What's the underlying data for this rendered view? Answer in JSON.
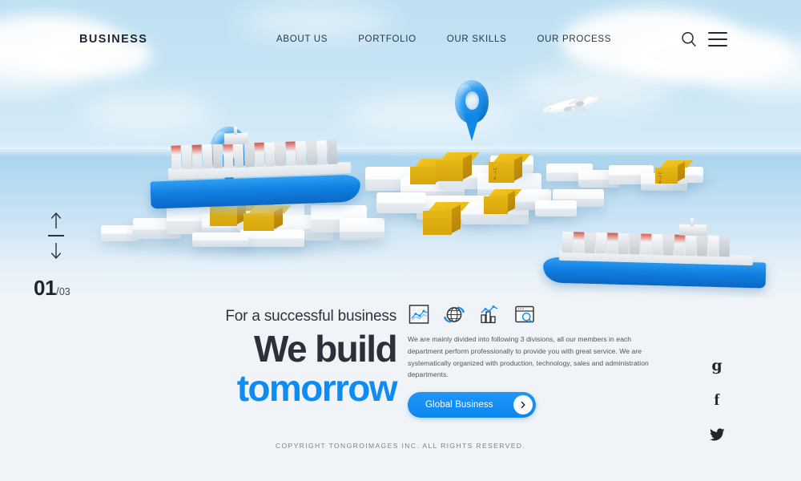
{
  "header": {
    "logo": "BUSINESS",
    "menu": [
      {
        "label": "ABOUT US"
      },
      {
        "label": "PORTFOLIO"
      },
      {
        "label": "OUR SKILLS"
      },
      {
        "label": "OUR PROCESS"
      }
    ],
    "search_icon": "search-icon",
    "menu_icon": "hamburger-menu-icon"
  },
  "slider": {
    "up_icon": "arrow-up-icon",
    "down_icon": "arrow-down-icon",
    "current": "01",
    "separator": "/",
    "total": "03"
  },
  "hero": {
    "kicker": "For a successful business",
    "line1": "We build",
    "line2": "tomorrow",
    "accent_color": "#0d8cf5",
    "heading_color": "#2b3138"
  },
  "features": {
    "icons": [
      {
        "name": "line-chart-icon",
        "label": "Analytics chart"
      },
      {
        "name": "globe-rotate-icon",
        "label": "Global network"
      },
      {
        "name": "bar-chart-trend-icon",
        "label": "Growth statistics"
      },
      {
        "name": "browser-search-icon",
        "label": "Search research"
      }
    ]
  },
  "body": {
    "paragraph": "We are mainly divided into following 3 divisions, all our members in each department perform professionally to provide you with great service. We are systematically organized with production, technology, sales and administration departments."
  },
  "cta": {
    "label": "Global Business",
    "icon": "chevron-right-icon",
    "color": "#0d86ef"
  },
  "social": [
    {
      "name": "google-icon",
      "glyph": "g"
    },
    {
      "name": "facebook-icon",
      "glyph": "f"
    },
    {
      "name": "twitter-icon",
      "glyph": "twitter-bird"
    }
  ],
  "footer": {
    "copyright": "COPYRIGHT TONGROIMAGES INC. ALL RIGHTS RESERVED."
  },
  "scene": {
    "description": "3D isometric world map with cargo ships, airplane, map pins and yellow shipping boxes",
    "sky_color": "#c4e2f3",
    "sea_color": "#b5daf0",
    "land_color": "#ffffff",
    "pin_color": "#1e96f0",
    "box_color": "#e8b514",
    "ship_hull_color": "#1180e2",
    "objects": [
      {
        "name": "map-pin-left",
        "type": "pin"
      },
      {
        "name": "map-pin-center",
        "type": "pin"
      },
      {
        "name": "cargo-ship-left",
        "type": "ship"
      },
      {
        "name": "cargo-ship-right",
        "type": "ship"
      },
      {
        "name": "airplane",
        "type": "plane"
      },
      {
        "name": "cargo-box-cluster-left",
        "type": "boxes"
      },
      {
        "name": "cargo-box-cluster-center",
        "type": "boxes"
      },
      {
        "name": "cargo-box-right",
        "type": "boxes"
      }
    ]
  }
}
